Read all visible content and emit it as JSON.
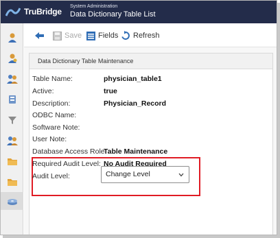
{
  "header": {
    "brand": "TruBridge",
    "breadcrumb_small": "System Administration",
    "window_title": "Data Dictionary Table List"
  },
  "rail": {
    "icons": [
      "person-icon",
      "person-icon",
      "group-icon",
      "database-icon",
      "filter-icon",
      "group-icon",
      "folder-icon",
      "folder-icon",
      "disk-icon"
    ]
  },
  "toolbar": {
    "back_icon": "back-arrow-icon",
    "save_label": "Save",
    "fields_label": "Fields",
    "refresh_label": "Refresh"
  },
  "panel": {
    "title": "Data Dictionary Table Maintenance"
  },
  "fields": {
    "table_name": {
      "label": "Table Name:",
      "value": "physician_table1"
    },
    "active": {
      "label": "Active:",
      "value": "true"
    },
    "description": {
      "label": "Description:",
      "value": "Physician_Record"
    },
    "odbc_name": {
      "label": "ODBC Name:",
      "value": ""
    },
    "software_note": {
      "label": "Software Note:",
      "value": ""
    },
    "user_note": {
      "label": "User Note:",
      "value": ""
    },
    "database_access_role": {
      "label": "Database Access Role:",
      "value": "Table Maintenance"
    },
    "required_audit_level": {
      "label": "Required Audit Level:",
      "value": "No Audit Required"
    },
    "audit_level": {
      "label": "Audit Level:",
      "selected": "Change Level"
    }
  },
  "colors": {
    "header_bg": "#232c4a",
    "highlight_border": "#e01b24",
    "accent_blue": "#2f6db5"
  }
}
